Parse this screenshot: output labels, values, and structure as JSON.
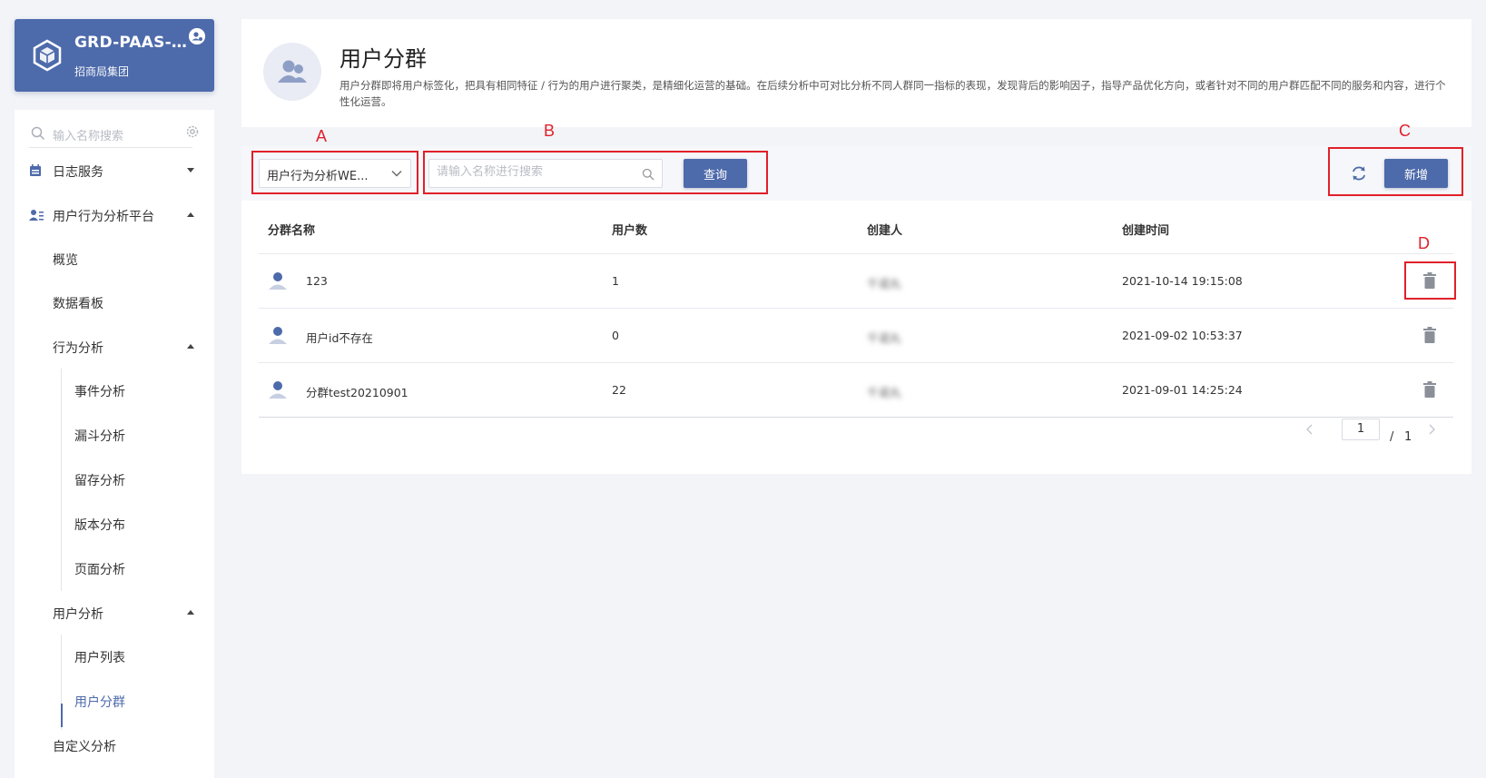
{
  "app": {
    "title": "GRD-PAAS-PO...",
    "subtitle": "招商局集团"
  },
  "sidebar": {
    "search_placeholder": "输入名称搜索",
    "items": [
      {
        "label": "日志服务"
      },
      {
        "label": "用户行为分析平台"
      },
      {
        "label": "概览"
      },
      {
        "label": "数据看板"
      },
      {
        "label": "行为分析"
      },
      {
        "label": "事件分析"
      },
      {
        "label": "漏斗分析"
      },
      {
        "label": "留存分析"
      },
      {
        "label": "版本分布"
      },
      {
        "label": "页面分析"
      },
      {
        "label": "用户分析"
      },
      {
        "label": "用户列表"
      },
      {
        "label": "用户分群"
      },
      {
        "label": "自定义分析"
      }
    ]
  },
  "header": {
    "title": "用户分群",
    "description": "用户分群即将用户标签化，把具有相同特征 / 行为的用户进行聚类，是精细化运营的基础。在后续分析中可对比分析不同人群同一指标的表现，发现背后的影响因子，指导产品优化方向，或者针对不同的用户群匹配不同的服务和内容，进行个性化运营。"
  },
  "toolbar": {
    "app_select": "用户行为分析WE...",
    "search_placeholder": "请输入名称进行搜索",
    "query_label": "查询",
    "add_label": "新增"
  },
  "table": {
    "columns": [
      "分群名称",
      "用户数",
      "创建人",
      "创建时间"
    ],
    "rows": [
      {
        "name": "123",
        "users": "1",
        "creator": "千诺丸",
        "created": "2021-10-14 19:15:08"
      },
      {
        "name": "用户id不存在",
        "users": "0",
        "creator": "千诺丸",
        "created": "2021-09-02 10:53:37"
      },
      {
        "name": "分群test20210901",
        "users": "22",
        "creator": "千诺丸",
        "created": "2021-09-01 14:25:24"
      }
    ]
  },
  "pagination": {
    "current": "1",
    "separator": "/",
    "total": "1"
  },
  "annotations": {
    "a": "A",
    "b": "B",
    "c": "C",
    "d": "D"
  },
  "colors": {
    "primary": "#4d6aab",
    "annotation": "#e0202a",
    "background": "#f2f4f8"
  }
}
